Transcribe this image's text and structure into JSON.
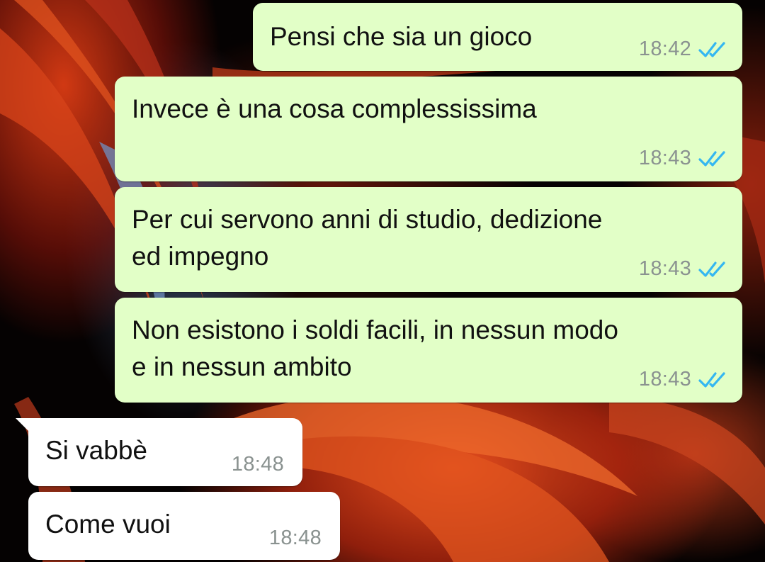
{
  "chat": {
    "messages": [
      {
        "direction": "outgoing",
        "text": "Pensi che sia un gioco",
        "time": "18:42",
        "status_icon": "double-check-read-icon"
      },
      {
        "direction": "outgoing",
        "text": "Invece è una cosa complessissima",
        "time": "18:43",
        "status_icon": "double-check-read-icon"
      },
      {
        "direction": "outgoing",
        "text": "Per cui servono anni di studio, dedizione\ned impegno",
        "time": "18:43",
        "status_icon": "double-check-read-icon"
      },
      {
        "direction": "outgoing",
        "text": "Non esistono i soldi facili, in nessun modo\ne in nessun ambito",
        "time": "18:43",
        "status_icon": "double-check-read-icon"
      },
      {
        "direction": "incoming",
        "text": "Si vabbè",
        "time": "18:48"
      },
      {
        "direction": "incoming",
        "text": "Come vuoi",
        "time": "18:48"
      }
    ]
  },
  "colors": {
    "outgoing_bubble": "#e2ffc7",
    "incoming_bubble": "#ffffff",
    "timestamp": "#8a9290",
    "read_ticks": "#34b7f1"
  },
  "wallpaper": {
    "description_icon": "fish-fin-wallpaper"
  }
}
